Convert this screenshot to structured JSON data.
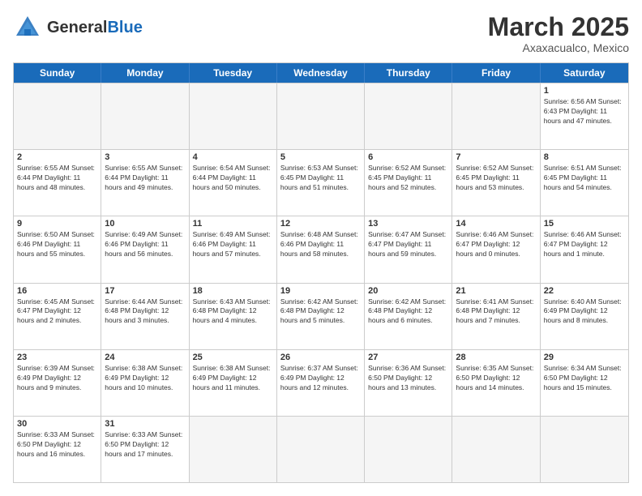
{
  "header": {
    "logo_general": "General",
    "logo_blue": "Blue",
    "month": "March 2025",
    "location": "Axaxacualco, Mexico"
  },
  "weekdays": [
    "Sunday",
    "Monday",
    "Tuesday",
    "Wednesday",
    "Thursday",
    "Friday",
    "Saturday"
  ],
  "weeks": [
    [
      {
        "day": "",
        "info": ""
      },
      {
        "day": "",
        "info": ""
      },
      {
        "day": "",
        "info": ""
      },
      {
        "day": "",
        "info": ""
      },
      {
        "day": "",
        "info": ""
      },
      {
        "day": "",
        "info": ""
      },
      {
        "day": "1",
        "info": "Sunrise: 6:56 AM\nSunset: 6:43 PM\nDaylight: 11 hours and 47 minutes."
      }
    ],
    [
      {
        "day": "2",
        "info": "Sunrise: 6:55 AM\nSunset: 6:44 PM\nDaylight: 11 hours and 48 minutes."
      },
      {
        "day": "3",
        "info": "Sunrise: 6:55 AM\nSunset: 6:44 PM\nDaylight: 11 hours and 49 minutes."
      },
      {
        "day": "4",
        "info": "Sunrise: 6:54 AM\nSunset: 6:44 PM\nDaylight: 11 hours and 50 minutes."
      },
      {
        "day": "5",
        "info": "Sunrise: 6:53 AM\nSunset: 6:45 PM\nDaylight: 11 hours and 51 minutes."
      },
      {
        "day": "6",
        "info": "Sunrise: 6:52 AM\nSunset: 6:45 PM\nDaylight: 11 hours and 52 minutes."
      },
      {
        "day": "7",
        "info": "Sunrise: 6:52 AM\nSunset: 6:45 PM\nDaylight: 11 hours and 53 minutes."
      },
      {
        "day": "8",
        "info": "Sunrise: 6:51 AM\nSunset: 6:45 PM\nDaylight: 11 hours and 54 minutes."
      }
    ],
    [
      {
        "day": "9",
        "info": "Sunrise: 6:50 AM\nSunset: 6:46 PM\nDaylight: 11 hours and 55 minutes."
      },
      {
        "day": "10",
        "info": "Sunrise: 6:49 AM\nSunset: 6:46 PM\nDaylight: 11 hours and 56 minutes."
      },
      {
        "day": "11",
        "info": "Sunrise: 6:49 AM\nSunset: 6:46 PM\nDaylight: 11 hours and 57 minutes."
      },
      {
        "day": "12",
        "info": "Sunrise: 6:48 AM\nSunset: 6:46 PM\nDaylight: 11 hours and 58 minutes."
      },
      {
        "day": "13",
        "info": "Sunrise: 6:47 AM\nSunset: 6:47 PM\nDaylight: 11 hours and 59 minutes."
      },
      {
        "day": "14",
        "info": "Sunrise: 6:46 AM\nSunset: 6:47 PM\nDaylight: 12 hours and 0 minutes."
      },
      {
        "day": "15",
        "info": "Sunrise: 6:46 AM\nSunset: 6:47 PM\nDaylight: 12 hours and 1 minute."
      }
    ],
    [
      {
        "day": "16",
        "info": "Sunrise: 6:45 AM\nSunset: 6:47 PM\nDaylight: 12 hours and 2 minutes."
      },
      {
        "day": "17",
        "info": "Sunrise: 6:44 AM\nSunset: 6:48 PM\nDaylight: 12 hours and 3 minutes."
      },
      {
        "day": "18",
        "info": "Sunrise: 6:43 AM\nSunset: 6:48 PM\nDaylight: 12 hours and 4 minutes."
      },
      {
        "day": "19",
        "info": "Sunrise: 6:42 AM\nSunset: 6:48 PM\nDaylight: 12 hours and 5 minutes."
      },
      {
        "day": "20",
        "info": "Sunrise: 6:42 AM\nSunset: 6:48 PM\nDaylight: 12 hours and 6 minutes."
      },
      {
        "day": "21",
        "info": "Sunrise: 6:41 AM\nSunset: 6:48 PM\nDaylight: 12 hours and 7 minutes."
      },
      {
        "day": "22",
        "info": "Sunrise: 6:40 AM\nSunset: 6:49 PM\nDaylight: 12 hours and 8 minutes."
      }
    ],
    [
      {
        "day": "23",
        "info": "Sunrise: 6:39 AM\nSunset: 6:49 PM\nDaylight: 12 hours and 9 minutes."
      },
      {
        "day": "24",
        "info": "Sunrise: 6:38 AM\nSunset: 6:49 PM\nDaylight: 12 hours and 10 minutes."
      },
      {
        "day": "25",
        "info": "Sunrise: 6:38 AM\nSunset: 6:49 PM\nDaylight: 12 hours and 11 minutes."
      },
      {
        "day": "26",
        "info": "Sunrise: 6:37 AM\nSunset: 6:49 PM\nDaylight: 12 hours and 12 minutes."
      },
      {
        "day": "27",
        "info": "Sunrise: 6:36 AM\nSunset: 6:50 PM\nDaylight: 12 hours and 13 minutes."
      },
      {
        "day": "28",
        "info": "Sunrise: 6:35 AM\nSunset: 6:50 PM\nDaylight: 12 hours and 14 minutes."
      },
      {
        "day": "29",
        "info": "Sunrise: 6:34 AM\nSunset: 6:50 PM\nDaylight: 12 hours and 15 minutes."
      }
    ],
    [
      {
        "day": "30",
        "info": "Sunrise: 6:33 AM\nSunset: 6:50 PM\nDaylight: 12 hours and 16 minutes."
      },
      {
        "day": "31",
        "info": "Sunrise: 6:33 AM\nSunset: 6:50 PM\nDaylight: 12 hours and 17 minutes."
      },
      {
        "day": "",
        "info": ""
      },
      {
        "day": "",
        "info": ""
      },
      {
        "day": "",
        "info": ""
      },
      {
        "day": "",
        "info": ""
      },
      {
        "day": "",
        "info": ""
      }
    ]
  ]
}
